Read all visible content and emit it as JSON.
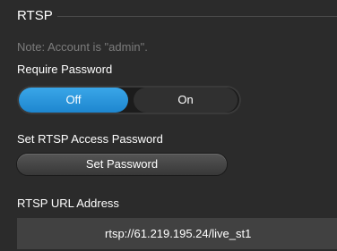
{
  "section": {
    "title": "RTSP"
  },
  "note": "Note: Account is \"admin\".",
  "require_password": {
    "label": "Require Password",
    "options": [
      {
        "label": "Off",
        "selected": true
      },
      {
        "label": "On",
        "selected": false
      }
    ]
  },
  "access_password": {
    "label": "Set RTSP Access Password",
    "button_label": "Set Password"
  },
  "url": {
    "label": "RTSP URL Address",
    "value": "rtsp://61.219.195.24/live_st1"
  },
  "colors": {
    "selected": "#1e86cf",
    "background": "#2b2b2b",
    "note": "#7c7c7c"
  }
}
